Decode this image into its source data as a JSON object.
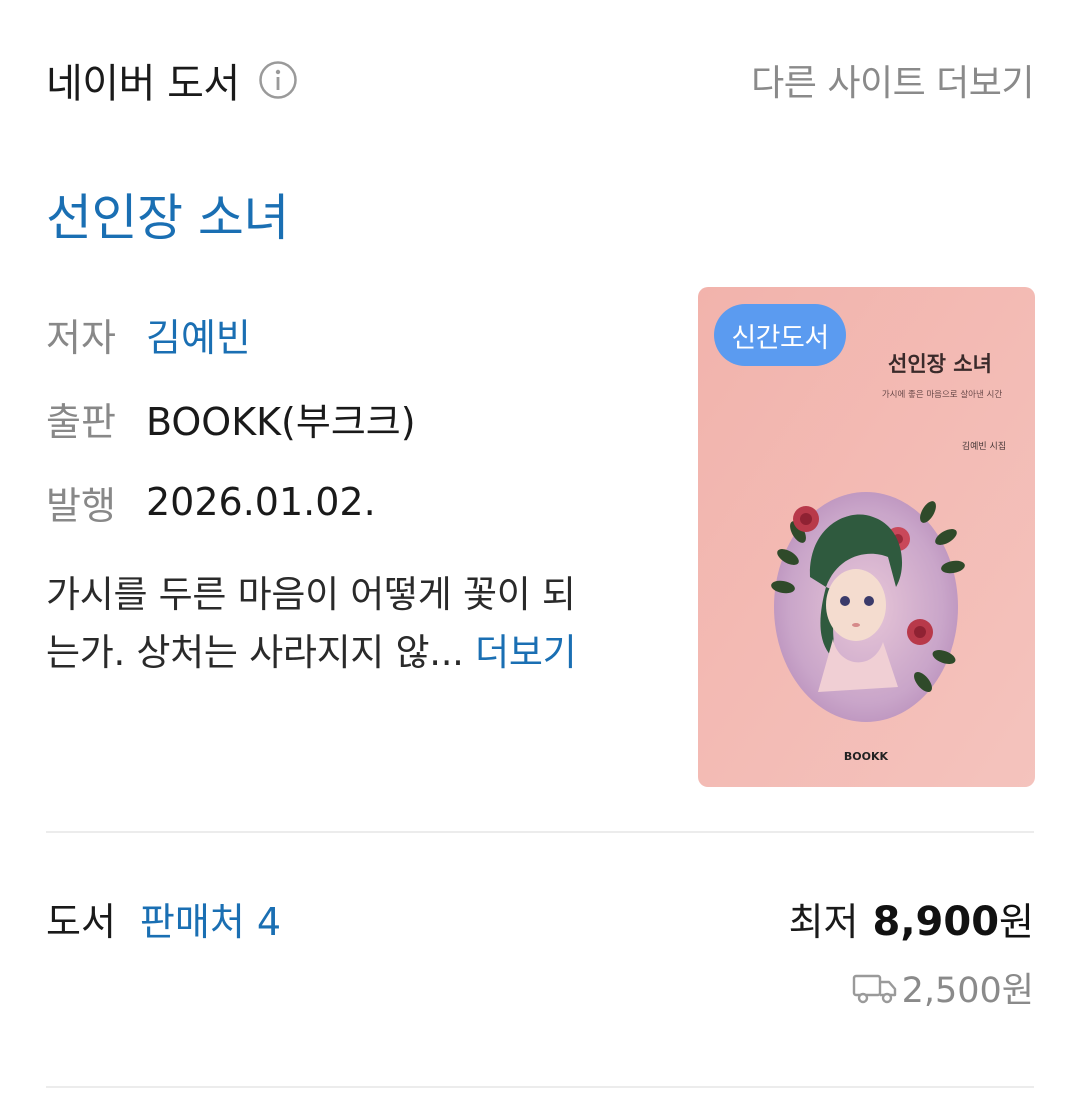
{
  "header": {
    "section_title": "네이버 도서",
    "more_sites_label": "다른 사이트 더보기"
  },
  "book": {
    "title": "선인장 소녀",
    "author_label": "저자",
    "author": "김예빈",
    "publisher_label": "출판",
    "publisher": "BOOKK(부크크)",
    "date_label": "발행",
    "date": "2026.01.02.",
    "description_line1": "가시를 두른 마음이 어떻게 꽃이 되",
    "description_line2": "는가. 상처는 사라지지 않...",
    "more_label": "더보기"
  },
  "cover": {
    "badge": "신간도서",
    "title": "선인장 소녀",
    "subtitle": "가시에 좋은 마음으로 살아낸 시간",
    "author_line": "김예빈 시집",
    "publisher_logo": "BOOKK"
  },
  "stores": {
    "label": "도서",
    "count_label": "판매처 4",
    "lowest_label": "최저",
    "lowest_price": "8,900",
    "price_unit": "원",
    "shipping": "2,500원"
  },
  "colors": {
    "link": "#1a6fb3",
    "badge": "#5b9bf0",
    "muted": "#8a8a8a"
  }
}
